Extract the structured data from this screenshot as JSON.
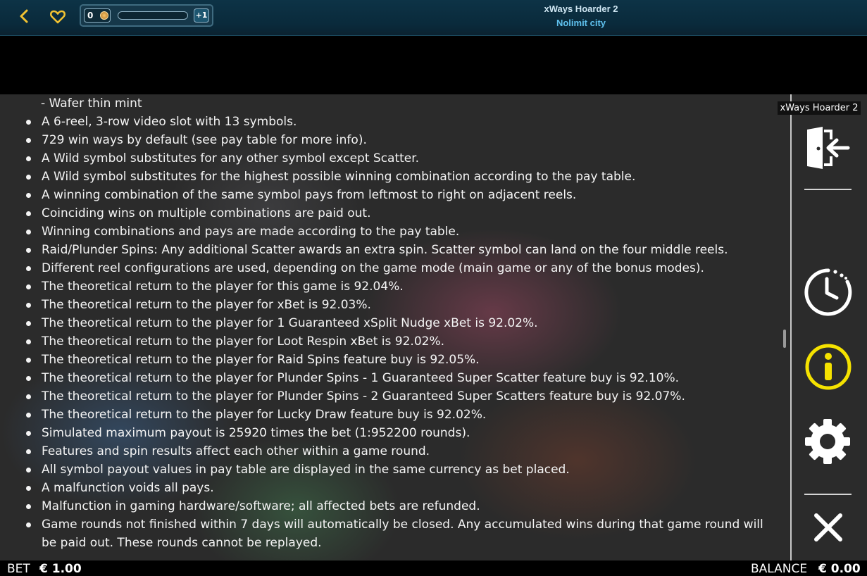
{
  "header": {
    "back_icon": "chevron-left-icon",
    "favorite_icon": "heart-icon",
    "accent_color": "#f1c232",
    "level": {
      "value": "0",
      "coin_icon": "coin-icon"
    },
    "progress": 0.0,
    "plus_label": "+1",
    "game_title": "xWays Hoarder 2",
    "provider": "Nolimit city"
  },
  "rules": {
    "lead_line": "- Wafer thin mint",
    "items": [
      "A 6-reel, 3-row video slot with 13 symbols.",
      "729 win ways by default (see pay table for more info).",
      "A Wild symbol substitutes for any other symbol except Scatter.",
      "A Wild symbol substitutes for the highest possible winning combination according to the pay table.",
      "A winning combination of the same symbol pays from leftmost to right on adjacent reels.",
      "Coinciding wins on multiple combinations are paid out.",
      "Winning combinations and pays are made according to the pay table.",
      "Raid/Plunder Spins: Any additional Scatter awards an extra spin. Scatter symbol can land on the four middle reels.",
      "Different reel configurations are used, depending on the game mode (main game or any of the bonus modes).",
      "The theoretical return to the player for this game is 92.04%.",
      "The theoretical return to the player for xBet is 92.03%.",
      "The theoretical return to the player for 1 Guaranteed xSplit Nudge xBet is 92.02%.",
      "The theoretical return to the player for Loot Respin xBet is 92.02%.",
      "The theoretical return to the player for Raid Spins feature buy is 92.05%.",
      "The theoretical return to the player for Plunder Spins - 1 Guaranteed Super Scatter feature buy is 92.10%.",
      "The theoretical return to the player for Plunder Spins - 2 Guaranteed Super Scatters feature buy is 92.07%.",
      "The theoretical return to the player for Lucky Draw feature buy is 92.02%.",
      "Simulated maximum payout is 25920 times the bet (1:952200 rounds).",
      "Features and spin results affect each other within a game round.",
      "All symbol payout values in pay table are displayed in the same currency as bet placed.",
      "A malfunction voids all pays.",
      "Malfunction in gaming hardware/software; all affected bets are refunded.",
      "Game rounds not finished within 7 days will automatically be closed. Any accumulated wins during that game round will be paid out. These rounds cannot be replayed."
    ]
  },
  "side_panel": {
    "title": "xWays Hoarder 2",
    "buttons": [
      {
        "icon": "exit-icon"
      },
      {
        "icon": "history-clock-icon"
      },
      {
        "icon": "info-icon",
        "color": "#f5e200"
      },
      {
        "icon": "settings-gear-icon"
      },
      {
        "icon": "close-icon"
      }
    ]
  },
  "footer": {
    "bet_label": "BET",
    "bet_value": "€ 1.00",
    "balance_label": "BALANCE",
    "balance_value": "€ 0.00"
  }
}
